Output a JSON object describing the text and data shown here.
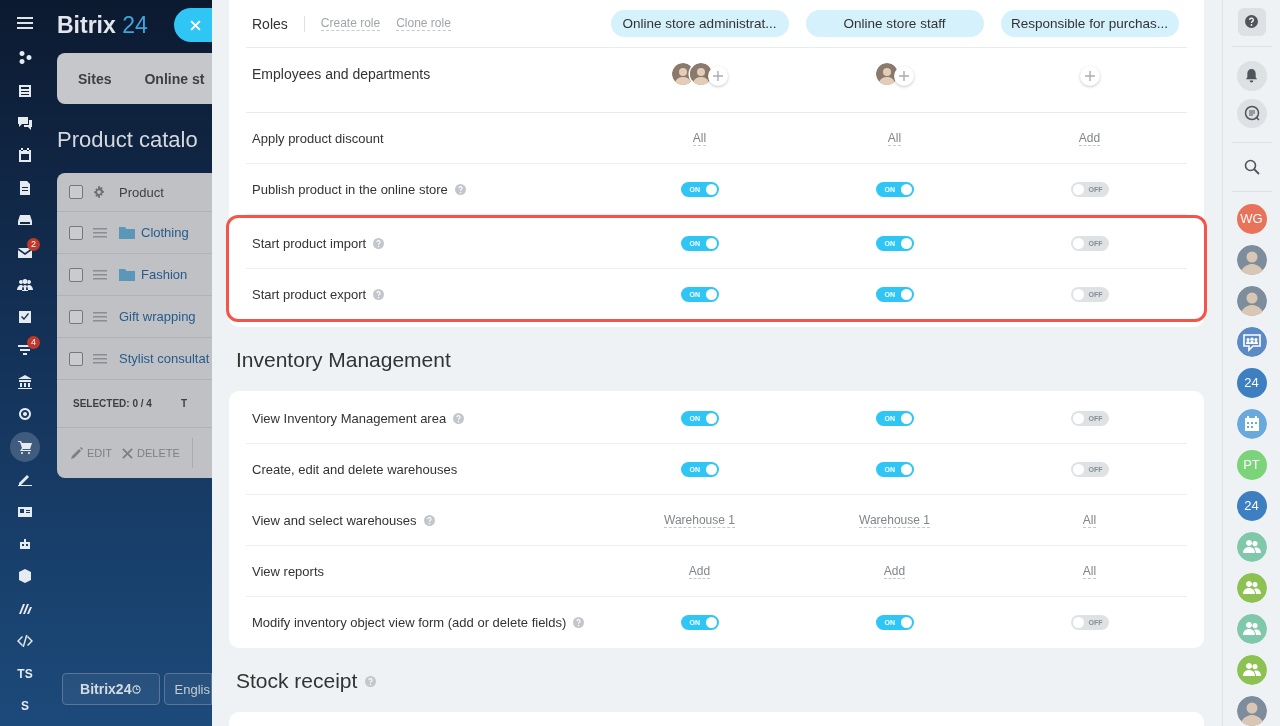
{
  "background_page": {
    "logo": {
      "name": "Bitrix",
      "number": "24"
    },
    "tabs": [
      "Sites",
      "Online st"
    ],
    "title": "Product catalo",
    "table": {
      "header": {
        "label": "Product",
        "checked": false
      },
      "rows": [
        {
          "name": "Clothing",
          "kind": "folder",
          "checked": false
        },
        {
          "name": "Fashion",
          "kind": "folder",
          "checked": false
        },
        {
          "name": "Gift wrapping",
          "kind": "item",
          "checked": false
        },
        {
          "name": "Stylist consultat",
          "kind": "item",
          "checked": false
        }
      ],
      "selected_label": "SELECTED:",
      "selected_count": "0 / 4",
      "column_2": "T",
      "actions": [
        {
          "label": "EDIT",
          "kind": "edit"
        },
        {
          "label": "DELETE",
          "kind": "delete"
        }
      ]
    },
    "footer": {
      "logo_button": "Bitrix24",
      "language": "Englis"
    }
  },
  "left_nav": [
    {
      "kind": "icon",
      "selected": false
    },
    {
      "kind": "icon",
      "selected": false
    },
    {
      "kind": "icon",
      "selected": false
    },
    {
      "kind": "icon",
      "selected": false
    },
    {
      "kind": "icon",
      "selected": false
    },
    {
      "kind": "icon",
      "selected": false
    },
    {
      "kind": "icon",
      "selected": false,
      "badge": "2"
    },
    {
      "kind": "icon",
      "selected": false
    },
    {
      "kind": "icon",
      "selected": false
    },
    {
      "kind": "icon",
      "selected": false,
      "badge": "4"
    },
    {
      "kind": "icon",
      "selected": false
    },
    {
      "kind": "icon",
      "selected": false
    },
    {
      "kind": "icon",
      "selected": true
    },
    {
      "kind": "icon",
      "selected": false
    },
    {
      "kind": "icon",
      "selected": false
    },
    {
      "kind": "icon",
      "selected": false
    },
    {
      "kind": "icon",
      "selected": false
    },
    {
      "kind": "icon",
      "selected": false
    },
    {
      "kind": "icon",
      "selected": false
    },
    {
      "kind": "text",
      "text": "TS",
      "selected": false
    },
    {
      "kind": "text",
      "text": "S",
      "selected": false
    }
  ],
  "roles": {
    "label": "Roles",
    "actions": [
      "Create role",
      "Clone role"
    ],
    "columns": [
      "Online store administrat...",
      "Online store staff",
      "Responsible for purchas..."
    ]
  },
  "employees": {
    "label": "Employees and departments",
    "cells": [
      {
        "members": [
          {
            "kind": "photo"
          },
          {
            "kind": "photo"
          }
        ]
      },
      {
        "members": [
          {
            "kind": "photo"
          }
        ]
      },
      {}
    ]
  },
  "permissions": [
    {
      "highlighted": false,
      "rows": [
        {
          "label": "Apply product discount",
          "help": false,
          "cells": [
            {
              "kind": "link",
              "text": "All"
            },
            {
              "kind": "link",
              "text": "All"
            },
            {
              "kind": "link",
              "text": "Add"
            }
          ]
        },
        {
          "label": "Publish product in the online store",
          "help": true,
          "cells": [
            {
              "kind": "toggle",
              "on": true,
              "text": "ON"
            },
            {
              "kind": "toggle",
              "on": true,
              "text": "ON"
            },
            {
              "kind": "toggle",
              "on": false,
              "text": "OFF"
            }
          ]
        }
      ]
    },
    {
      "highlighted": true,
      "rows": [
        {
          "label": "Start product import",
          "help": true,
          "cells": [
            {
              "kind": "toggle",
              "on": true,
              "text": "ON"
            },
            {
              "kind": "toggle",
              "on": true,
              "text": "ON"
            },
            {
              "kind": "toggle",
              "on": false,
              "text": "OFF"
            }
          ]
        },
        {
          "label": "Start product export",
          "help": true,
          "cells": [
            {
              "kind": "toggle",
              "on": true,
              "text": "ON"
            },
            {
              "kind": "toggle",
              "on": true,
              "text": "ON"
            },
            {
              "kind": "toggle",
              "on": false,
              "text": "OFF"
            }
          ]
        }
      ]
    }
  ],
  "sections": [
    {
      "title": "Inventory Management",
      "help": false,
      "rows": [
        {
          "label": "View Inventory Management area",
          "help": true,
          "cells": [
            {
              "kind": "toggle",
              "on": true,
              "text": "ON"
            },
            {
              "kind": "toggle",
              "on": true,
              "text": "ON"
            },
            {
              "kind": "toggle",
              "on": false,
              "text": "OFF"
            }
          ]
        },
        {
          "label": "Create, edit and delete warehouses",
          "help": false,
          "cells": [
            {
              "kind": "toggle",
              "on": true,
              "text": "ON"
            },
            {
              "kind": "toggle",
              "on": true,
              "text": "ON"
            },
            {
              "kind": "toggle",
              "on": false,
              "text": "OFF"
            }
          ]
        },
        {
          "label": "View and select warehouses",
          "help": true,
          "cells": [
            {
              "kind": "link",
              "text": "Warehouse 1"
            },
            {
              "kind": "link",
              "text": "Warehouse 1"
            },
            {
              "kind": "link",
              "text": "All"
            }
          ]
        },
        {
          "label": "View reports",
          "help": false,
          "cells": [
            {
              "kind": "link",
              "text": "Add"
            },
            {
              "kind": "link",
              "text": "Add"
            },
            {
              "kind": "link",
              "text": "All"
            }
          ]
        },
        {
          "label": "Modify inventory object view form (add or delete fields)",
          "help": true,
          "cells": [
            {
              "kind": "toggle",
              "on": true,
              "text": "ON"
            },
            {
              "kind": "toggle",
              "on": true,
              "text": "ON"
            },
            {
              "kind": "toggle",
              "on": false,
              "text": "OFF"
            }
          ]
        }
      ]
    },
    {
      "title": "Stock receipt",
      "help": true
    }
  ],
  "right_bar": [
    {
      "kind": "initials",
      "text": "WG",
      "color": "#e8735a"
    },
    {
      "kind": "photo"
    },
    {
      "kind": "photo"
    },
    {
      "kind": "group_chat",
      "color": "#5b8ac4"
    },
    {
      "kind": "initials",
      "text": "24",
      "color": "#3d7fc1"
    },
    {
      "kind": "calendar",
      "color": "#69a9dc"
    },
    {
      "kind": "initials",
      "text": "PT",
      "color": "#7bd47a"
    },
    {
      "kind": "initials",
      "text": "24",
      "color": "#3d7fc1"
    },
    {
      "kind": "group",
      "color": "#7fc8aa"
    },
    {
      "kind": "group",
      "color": "#8dc152"
    },
    {
      "kind": "group",
      "color": "#7fc8aa"
    },
    {
      "kind": "group",
      "color": "#8dc152"
    },
    {
      "kind": "photo"
    }
  ]
}
